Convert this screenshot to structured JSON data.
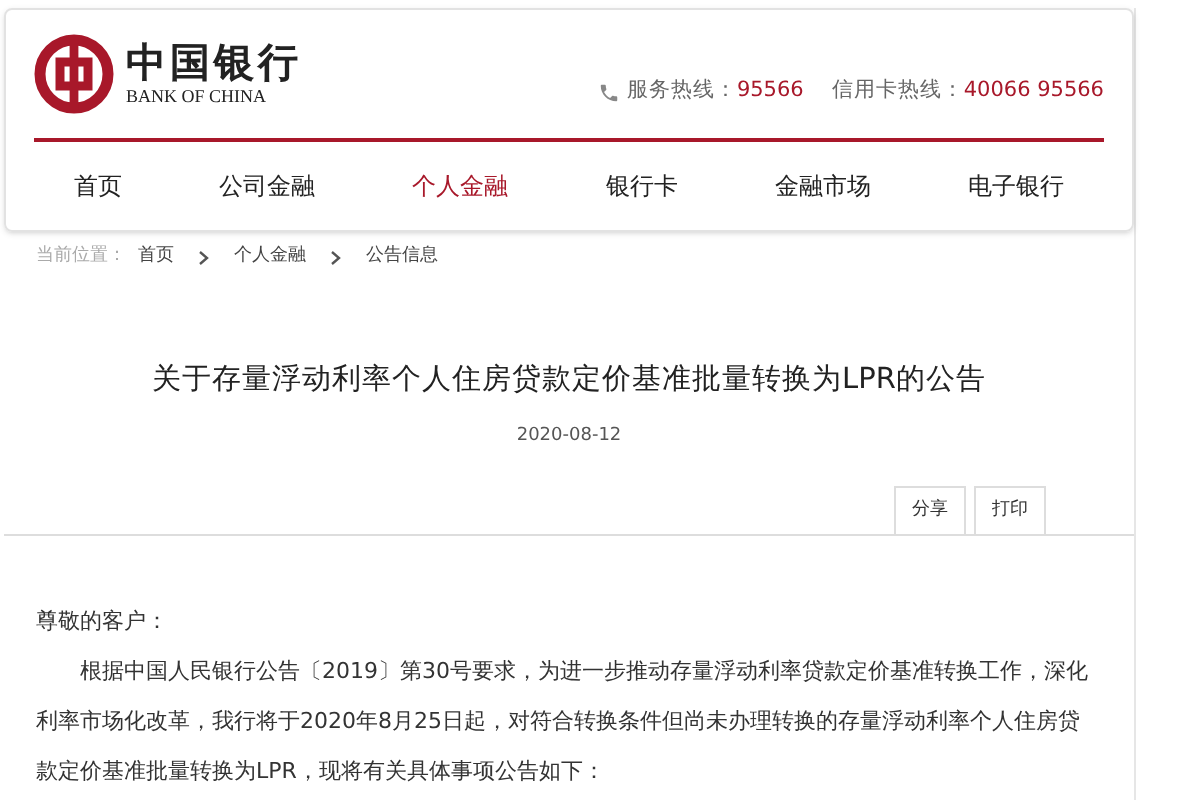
{
  "header": {
    "logo_cn": "中国银行",
    "logo_en": "BANK OF CHINA",
    "hotlines": [
      {
        "label": "服务热线：",
        "number": "95566"
      },
      {
        "label": "信用卡热线：",
        "number": "40066 95566"
      }
    ]
  },
  "nav": [
    {
      "label": "首页",
      "selected": false
    },
    {
      "label": "公司金融",
      "selected": false
    },
    {
      "label": "个人金融",
      "selected": true
    },
    {
      "label": "银行卡",
      "selected": false
    },
    {
      "label": "金融市场",
      "selected": false
    },
    {
      "label": "电子银行",
      "selected": false
    }
  ],
  "breadcrumb": {
    "prefix": "当前位置：",
    "items": [
      "首页",
      "个人金融",
      "公告信息"
    ]
  },
  "article": {
    "title": "关于存量浮动利率个人住房贷款定价基准批量转换为LPR的公告",
    "date": "2020-08-12",
    "actions": [
      "分享",
      "打印"
    ],
    "greeting": "尊敬的客户：",
    "paragraphs": [
      "根据中国人民银行公告〔2019〕第30号要求，为进一步推动存量浮动利率贷款定价基准转换工作，深化利率市场化改革，我行将于2020年8月25日起，对符合转换条件但尚未办理转换的存量浮动利率个人住房贷款定价基准批量转换为LPR，现将有关具体事项公告如下："
    ]
  }
}
